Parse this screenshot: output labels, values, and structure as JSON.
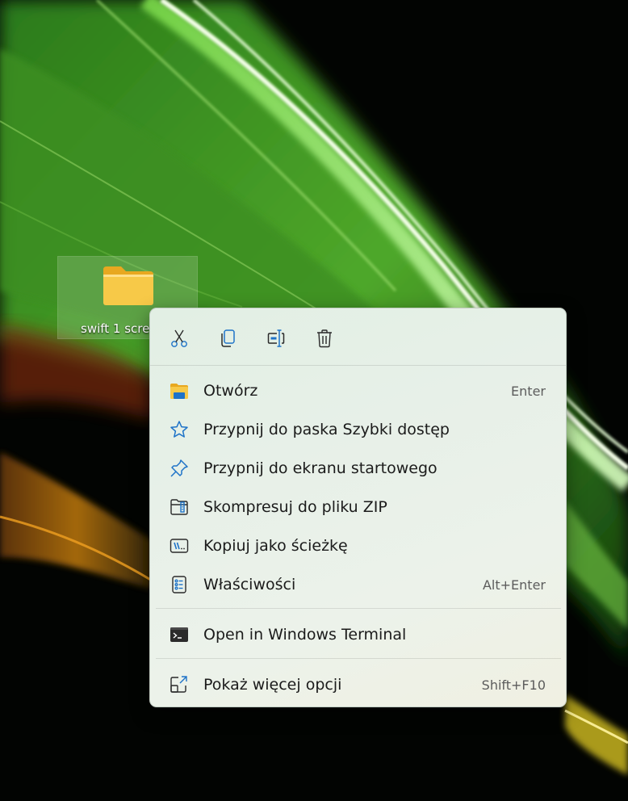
{
  "desktop": {
    "folder_label": "swift 1 scre"
  },
  "toolbar": {
    "buttons": [
      {
        "icon": "scissors-icon",
        "name": "cut"
      },
      {
        "icon": "copy-icon",
        "name": "copy"
      },
      {
        "icon": "rename-icon",
        "name": "rename"
      },
      {
        "icon": "trash-icon",
        "name": "delete"
      }
    ]
  },
  "menu": {
    "items": [
      {
        "label": "Otwórz",
        "shortcut": "Enter",
        "icon": "folder-open-icon"
      },
      {
        "label": "Przypnij do paska Szybki dostęp",
        "shortcut": "",
        "icon": "star-icon"
      },
      {
        "label": "Przypnij do ekranu startowego",
        "shortcut": "",
        "icon": "pin-icon"
      },
      {
        "label": "Skompresuj do pliku ZIP",
        "shortcut": "",
        "icon": "zip-icon"
      },
      {
        "label": "Kopiuj jako ścieżkę",
        "shortcut": "",
        "icon": "path-copy-icon"
      },
      {
        "label": "Właściwości",
        "shortcut": "Alt+Enter",
        "icon": "properties-icon"
      },
      {
        "label": "Open in Windows Terminal",
        "shortcut": "",
        "icon": "terminal-icon"
      },
      {
        "label": "Pokaż więcej opcji",
        "shortcut": "Shift+F10",
        "icon": "more-options-icon"
      }
    ]
  },
  "colors": {
    "accent": "#1e73c8",
    "folder_yellow": "#f7c948",
    "menu_text": "#1b1b1b",
    "shortcut_text": "#5c5c5c"
  }
}
